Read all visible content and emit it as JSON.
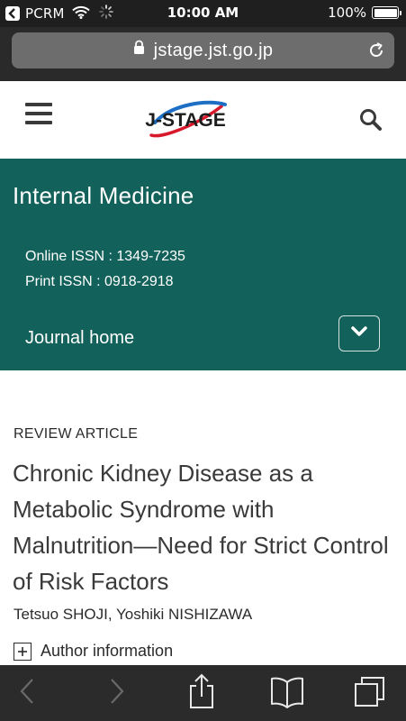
{
  "status_bar": {
    "carrier": "PCRM",
    "time": "10:00 AM",
    "battery": "100%"
  },
  "browser": {
    "url": "jstage.jst.go.jp"
  },
  "site": {
    "logo_text": "J-STAGE",
    "logo_colors": {
      "text": "#1c1c1c",
      "swoosh_blue": "#1c6fc4",
      "swoosh_red": "#d8192b"
    }
  },
  "journal": {
    "title": "Internal Medicine",
    "online_issn": "Online ISSN : 1349-7235",
    "print_issn": "Print ISSN : 0918-2918",
    "home_label": "Journal home",
    "banner_color": "#13615b"
  },
  "article": {
    "type": "REVIEW ARTICLE",
    "title": "Chronic Kidney Disease as a Metabolic Syndrome with Malnutrition—Need for Strict Control of Risk Factors",
    "authors": "Tetsuo SHOJI, Yoshiki NISHIZAWA",
    "author_info_label": "Author information"
  },
  "icons": {
    "status_back": "back-to-app-icon",
    "wifi": "wifi-icon",
    "activity": "activity-spinner-icon",
    "lock": "lock-icon",
    "reload": "reload-icon",
    "menu": "hamburger-menu-icon",
    "search": "search-icon",
    "expand": "chevron-down-icon",
    "author_toggle": "plus-box-icon",
    "toolbar": [
      "back-arrow-icon",
      "forward-arrow-icon",
      "share-icon",
      "bookmarks-icon",
      "tabs-icon"
    ]
  }
}
